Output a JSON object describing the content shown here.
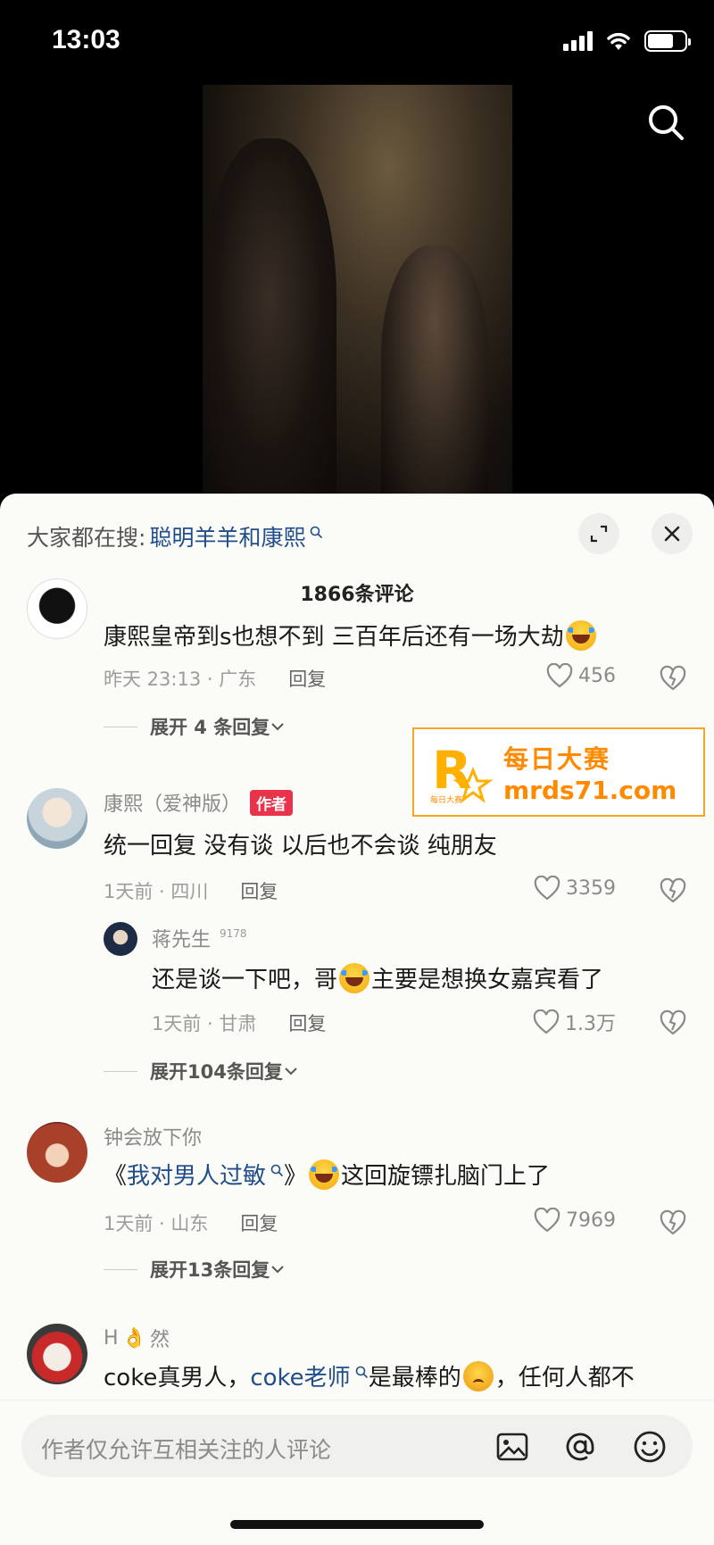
{
  "status_bar": {
    "time": "13:03",
    "battery_level": 0.7
  },
  "video": {
    "search_icon": "search-icon"
  },
  "sheet": {
    "hot_search_prefix": "大家都在搜:",
    "hot_search_term": "聪明羊羊和康熙",
    "comment_count": "1866条评论"
  },
  "comments": [
    {
      "text": "康熙皇帝到s也想不到 三百年后还有一场大劫",
      "time": "昨天 23:13 · 广东",
      "reply": "回复",
      "likes": "456",
      "expand": "展开 4 条回复"
    },
    {
      "author": "康熙（爱神版）",
      "tag": "作者",
      "text": "统一回复 没有谈 以后也不会谈 纯朋友",
      "time": "1天前 · 四川",
      "reply": "回复",
      "likes": "3359",
      "sub_reply": {
        "author": "蒋先生",
        "author_mark": "9178",
        "text_before": "还是谈一下吧，哥",
        "text_after": "主要是想换女嘉宾看了",
        "time": "1天前 · 甘肃",
        "reply": "回复",
        "likes": "1.3万"
      },
      "expand": "展开104条回复"
    },
    {
      "author": "钟会放下你",
      "text_open": "《",
      "text_link": "我对男人过敏",
      "text_close": "》",
      "text_after": "这回旋镖扎脑门上了",
      "time": "1天前 · 山东",
      "reply": "回复",
      "likes": "7969",
      "expand": "展开13条回复"
    },
    {
      "author_before": "H",
      "author_after": "然",
      "text_before": "coke真男人，",
      "text_link": "coke老师",
      "text_after": "是最棒的",
      "text_tail": "，任何人都不"
    }
  ],
  "watermark": {
    "cn": "每日大赛",
    "url": "mrds71.com",
    "logo_letter": "R",
    "logo_small": "每日大赛"
  },
  "input": {
    "placeholder": "作者仅允许互相关注的人评论"
  }
}
